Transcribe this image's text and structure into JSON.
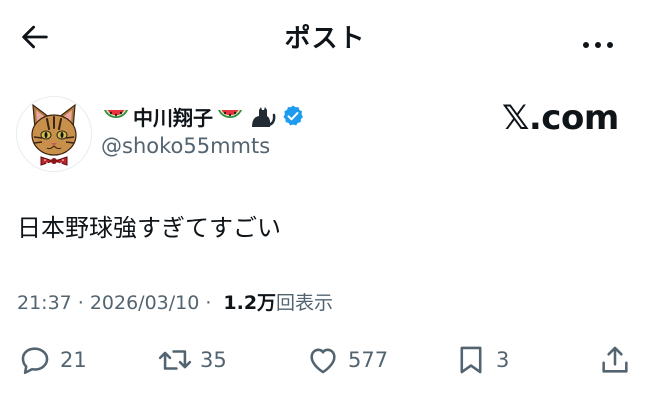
{
  "header": {
    "title": "ポスト",
    "back_icon": "arrow-left-icon",
    "more_icon": "more-horizontal-icon"
  },
  "author": {
    "display_name": "中川翔子",
    "handle": "@shoko55mmts",
    "name_emojis": [
      "watermelon-icon",
      "watermelon-icon",
      "black-cat-icon"
    ],
    "verified": true,
    "verified_color": "#1d9bf0"
  },
  "brand": {
    "label": "𝕏.com"
  },
  "post": {
    "text": "日本野球強すぎてすごい"
  },
  "meta": {
    "time": "21:37",
    "separator": "·",
    "date": "2026/03/10",
    "views": "1.2万",
    "views_suffix": "回表示"
  },
  "actions": {
    "reply": {
      "icon": "reply-icon",
      "count": "21"
    },
    "repost": {
      "icon": "repost-icon",
      "count": "35"
    },
    "like": {
      "icon": "heart-icon",
      "count": "577"
    },
    "bookmark": {
      "icon": "bookmark-icon",
      "count": "3"
    },
    "share": {
      "icon": "share-icon"
    }
  },
  "colors": {
    "text": "#0f1419",
    "secondary": "#536471",
    "accent": "#1d9bf0"
  }
}
